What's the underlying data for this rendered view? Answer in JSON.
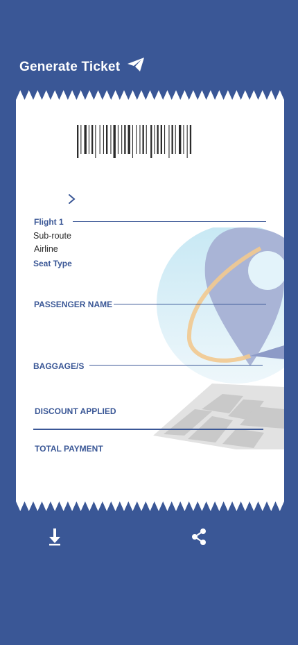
{
  "header": {
    "title": "Generate Ticket",
    "icon": "paper-plane-icon"
  },
  "ticket": {
    "flight_label": "Flight 1",
    "sub_route": "Sub-route",
    "airline": "Airline",
    "seat_type": "Seat Type",
    "passenger_name_label": "PASSENGER NAME",
    "baggage_label": "BAGGAGE/S",
    "discount_label": "DISCOUNT APPLIED",
    "total_label": "TOTAL PAYMENT"
  },
  "actions": {
    "download_icon": "download-arrow-icon",
    "share_icon": "share-icon"
  },
  "colors": {
    "background": "#3a5796",
    "ticket": "#ffffff",
    "accent": "#3a5796"
  }
}
